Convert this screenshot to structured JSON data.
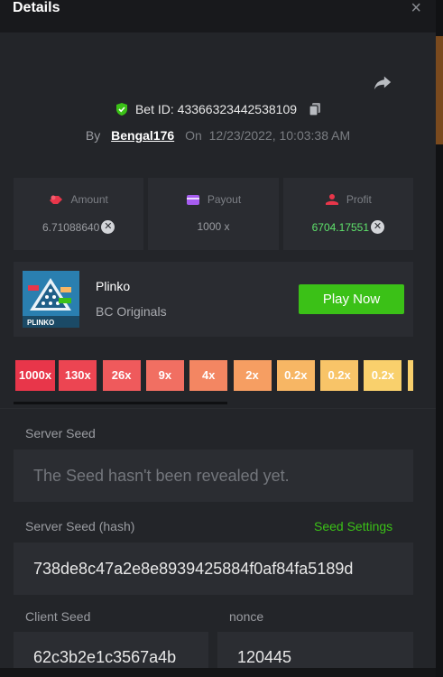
{
  "header": {
    "title": "Details",
    "close_glyph": "×"
  },
  "bet": {
    "id_text": "Bet ID: 43366323442538109",
    "by": "By",
    "user": "Bengal176",
    "on": "On",
    "datetime": "12/23/2022, 10:03:38 AM"
  },
  "stats": {
    "amount": {
      "label": "Amount",
      "value": "6.71088640"
    },
    "payout": {
      "label": "Payout",
      "value": "1000 x"
    },
    "profit": {
      "label": "Profit",
      "value": "6704.17551"
    }
  },
  "game": {
    "name": "Plinko",
    "provider": "BC Originals",
    "play_label": "Play Now",
    "thumb_label": "PLINKO"
  },
  "multipliers": [
    "1000x",
    "130x",
    "26x",
    "9x",
    "4x",
    "2x",
    "0.2x",
    "0.2x",
    "0.2x"
  ],
  "multiplier_colors": [
    "#e8364a",
    "#ec4552",
    "#ef5a5c",
    "#f16f62",
    "#f38662",
    "#f69e62",
    "#f7b664",
    "#f8c468",
    "#f9d06c"
  ],
  "seeds": {
    "server_seed_label": "Server Seed",
    "server_seed_value": "The Seed hasn't been revealed yet.",
    "server_hash_label": "Server Seed (hash)",
    "seed_settings_label": "Seed Settings",
    "server_hash_value": "738de8c47a2e8e8939425884f0af84fa5189d",
    "client_seed_label": "Client Seed",
    "client_seed_value": "62c3b2e1c3567a4b",
    "nonce_label": "nonce",
    "nonce_value": "120445"
  },
  "colors": {
    "accent": "#3bc117",
    "profit": "#5fe36c",
    "background": "#232529"
  }
}
